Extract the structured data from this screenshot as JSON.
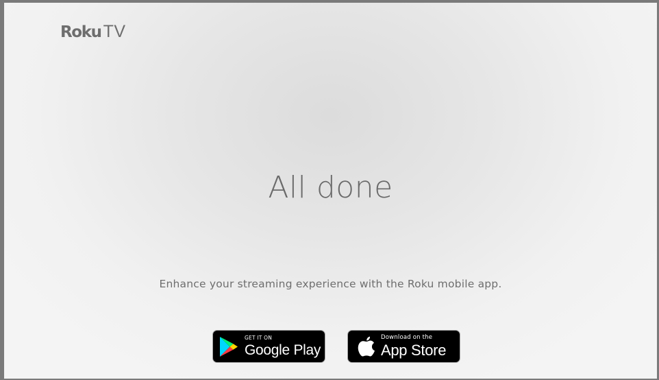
{
  "brand": {
    "name": "Roku",
    "product": "TV"
  },
  "main": {
    "heading": "All done",
    "subtitle": "Enhance your streaming experience with the Roku mobile app."
  },
  "badges": {
    "google": {
      "small_text": "GET IT ON",
      "big_text": "Google Play",
      "icon": "google-play-icon"
    },
    "apple": {
      "small_text": "Download on the",
      "big_text": "App Store",
      "icon": "apple-icon"
    }
  },
  "colors": {
    "text": "#6e6e6e",
    "frame": "#7a7a7a",
    "background": "#e8e8e8",
    "badge_background": "#000000",
    "badge_text": "#ffffff"
  }
}
